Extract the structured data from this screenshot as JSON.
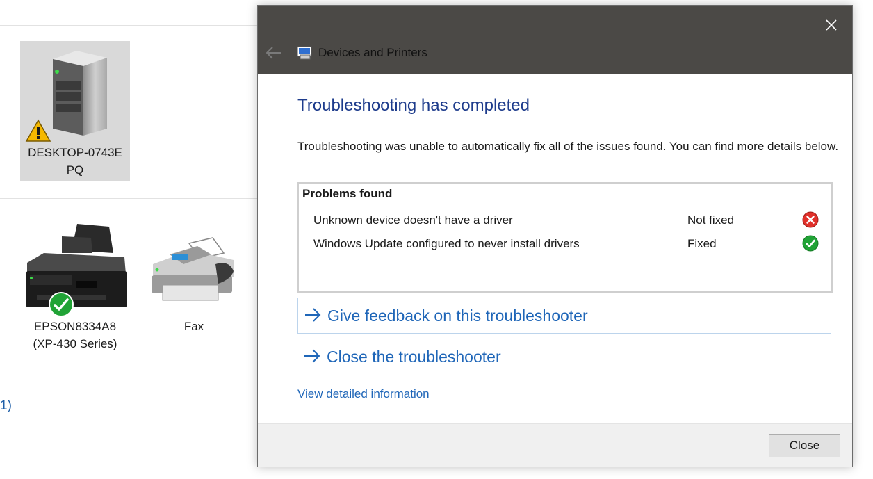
{
  "explorer": {
    "section_count": "1)",
    "devices": [
      {
        "name": "DESKTOP-0743E\nPQ",
        "line1": "DESKTOP-0743E",
        "line2": "PQ",
        "badge": "warning-icon"
      },
      {
        "name": "EPSON8334A8 (XP-430 Series)",
        "line1": "EPSON8334A8",
        "line2": "(XP-430 Series)",
        "badge": "check-icon"
      },
      {
        "name": "Fax",
        "line1": "Fax"
      }
    ]
  },
  "dialog": {
    "window_title": "Devices and Printers",
    "heading": "Troubleshooting has completed",
    "description": "Troubleshooting was unable to automatically fix all of the issues found. You can find more details below.",
    "problems_title": "Problems found",
    "problems": [
      {
        "name": "Unknown device doesn't have a driver",
        "status": "Not fixed",
        "icon": "error-icon"
      },
      {
        "name": "Windows Update configured to never install drivers",
        "status": "Fixed",
        "icon": "check-icon"
      }
    ],
    "feedback_link": "Give feedback on this troubleshooter",
    "close_link": "Close the troubleshooter",
    "details_link": "View detailed information",
    "close_button": "Close"
  },
  "colors": {
    "titlebar": "#4b4946",
    "heading": "#1e3c8c",
    "link": "#1f66b8",
    "error": "#e0302a",
    "success": "#21a336",
    "warning": "#f5b800"
  }
}
